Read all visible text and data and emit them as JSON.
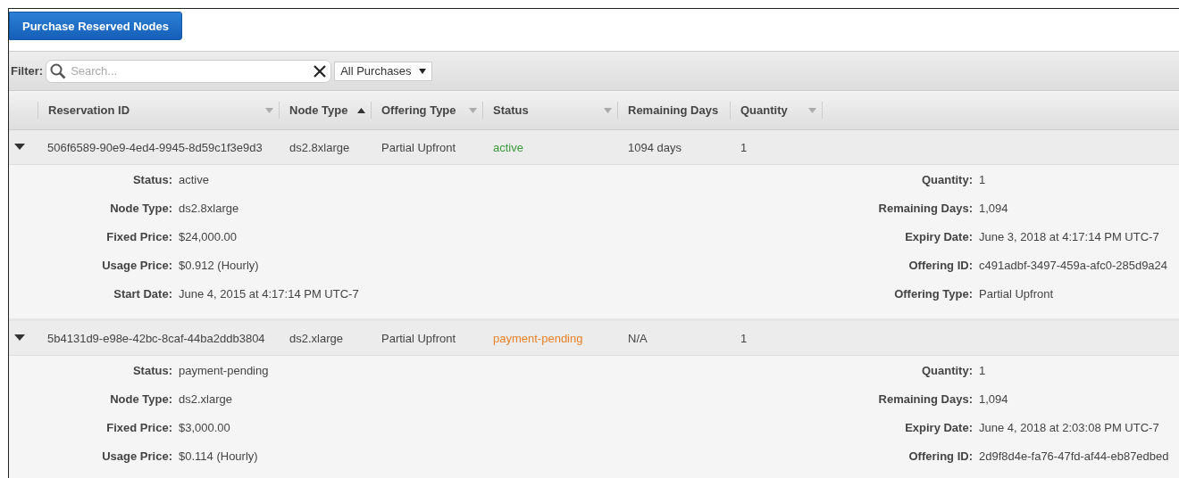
{
  "toolbar": {
    "purchase_button": "Purchase Reserved Nodes"
  },
  "filter": {
    "label": "Filter:",
    "search": {
      "placeholder": "Search..."
    },
    "dropdown": "All Purchases"
  },
  "table": {
    "columns": [
      {
        "label": "Reservation ID",
        "sorted": false,
        "has_menu": true
      },
      {
        "label": "Node Type",
        "sorted": true,
        "has_menu": false
      },
      {
        "label": "Offering Type",
        "sorted": false,
        "has_menu": true
      },
      {
        "label": "Status",
        "sorted": false,
        "has_menu": true
      },
      {
        "label": "Remaining Days",
        "sorted": false,
        "has_menu": false
      },
      {
        "label": "Quantity",
        "sorted": false,
        "has_menu": true
      }
    ],
    "rows": [
      {
        "expanded": true,
        "cells": [
          "506f6589-90e9-4ed4-9945-8d59c1f3e9d3",
          "ds2.8xlarge",
          "Partial Upfront",
          "active",
          "1094 days",
          "1"
        ],
        "color": "#3a9a3a",
        "details_left": [
          {
            "label": "Status:",
            "value": "active"
          },
          {
            "label": "Node Type:",
            "value": "ds2.8xlarge"
          },
          {
            "label": "Fixed Price:",
            "value": "$24,000.00"
          },
          {
            "label": "Usage Price:",
            "value": "$0.912 (Hourly)"
          },
          {
            "label": "Start Date:",
            "value": "June 4, 2015 at 4:17:14 PM UTC-7"
          }
        ],
        "details_right": [
          {
            "label": "Quantity:",
            "value": "1"
          },
          {
            "label": "Remaining Days:",
            "value": "1,094"
          },
          {
            "label": "Expiry Date:",
            "value": "June 3, 2018 at 4:17:14 PM UTC-7"
          },
          {
            "label": "Offering ID:",
            "value": "c491adbf-3497-459a-afc0-285d9a24"
          },
          {
            "label": "Offering Type:",
            "value": "Partial Upfront"
          }
        ]
      },
      {
        "expanded": true,
        "cells": [
          "5b4131d9-e98e-42bc-8caf-44ba2ddb3804",
          "ds2.xlarge",
          "Partial Upfront",
          "payment-pending",
          "N/A",
          "1"
        ],
        "color": "#e8822a",
        "details_left": [
          {
            "label": "Status:",
            "value": "payment-pending"
          },
          {
            "label": "Node Type:",
            "value": "ds2.xlarge"
          },
          {
            "label": "Fixed Price:",
            "value": "$3,000.00"
          },
          {
            "label": "Usage Price:",
            "value": "$0.114 (Hourly)"
          }
        ],
        "details_right": [
          {
            "label": "Quantity:",
            "value": "1"
          },
          {
            "label": "Remaining Days:",
            "value": "1,094"
          },
          {
            "label": "Expiry Date:",
            "value": "June 4, 2018 at 2:03:08 PM UTC-7"
          },
          {
            "label": "Offering ID:",
            "value": "2d9f8d4e-fa76-47fd-af44-eb87edbed"
          }
        ]
      }
    ]
  }
}
